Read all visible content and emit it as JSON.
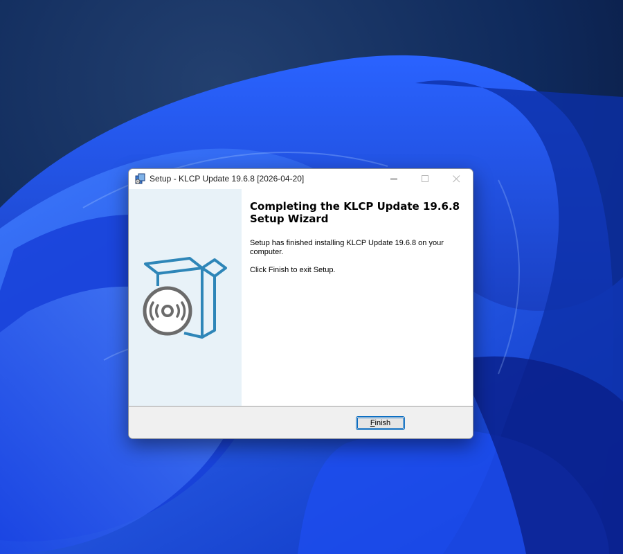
{
  "desktop": {
    "wallpaper": "windows-11-bloom",
    "colors": {
      "dark": "#0b1e4a",
      "blue": "#1f4fe0",
      "bright": "#3b74ff"
    }
  },
  "window": {
    "title": "Setup - KLCP Update 19.6.8 [2026-04-20]",
    "icon": "installer-icon",
    "controls": [
      "minimize-icon",
      "maximize-icon",
      "close-icon"
    ]
  },
  "sidebar": {
    "art": "box-with-disc-icon",
    "background": "#e8f2f8",
    "accent": "#2e86b8"
  },
  "content": {
    "heading": "Completing the KLCP Update 19.6.8 Setup Wizard",
    "message": "Setup has finished installing KLCP Update 19.6.8 on your computer.",
    "instruction": "Click Finish to exit Setup."
  },
  "footer": {
    "finish_label": "Finish",
    "finish_accel": "F",
    "finish_rest": "inish"
  }
}
